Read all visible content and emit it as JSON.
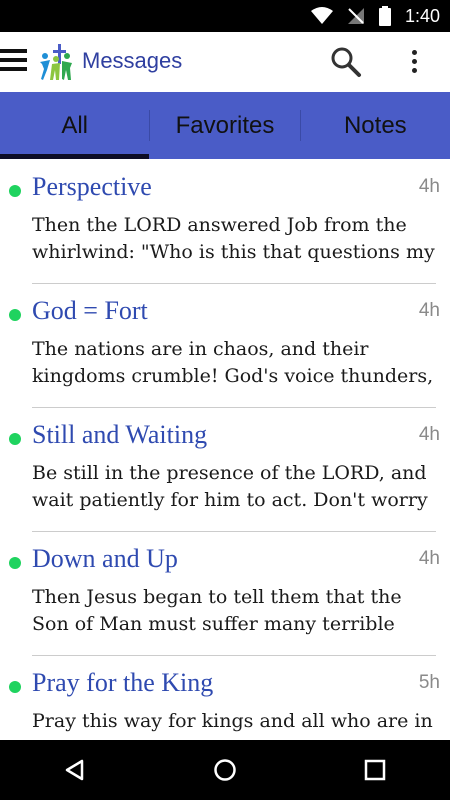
{
  "status": {
    "time": "1:40"
  },
  "appbar": {
    "title": "Messages"
  },
  "tabs": [
    {
      "label": "All",
      "active": true
    },
    {
      "label": "Favorites",
      "active": false
    },
    {
      "label": "Notes",
      "active": false
    }
  ],
  "messages": [
    {
      "title": "Perspective",
      "time": "4h",
      "snippet": "Then the LORD answered Job from the whirlwind: \"Who is this that questions my"
    },
    {
      "title": "God = Fort",
      "time": "4h",
      "snippet": "The nations are in chaos, and their kingdoms crumble! God's voice thunders,"
    },
    {
      "title": "Still and Waiting",
      "time": "4h",
      "snippet": "Be still in the presence of the LORD, and wait patiently for him to act. Don't worry"
    },
    {
      "title": "Down and Up",
      "time": "4h",
      "snippet": "Then Jesus began to tell them that the Son of Man must suffer many terrible things"
    },
    {
      "title": "Pray for the King",
      "time": "5h",
      "snippet": "Pray this way for kings and all who are in authority so that we can live peaceful and"
    }
  ],
  "colors": {
    "tab_bar": "#4a5cc7",
    "title": "#2f4ab0",
    "unread_dot": "#1fd35f"
  }
}
